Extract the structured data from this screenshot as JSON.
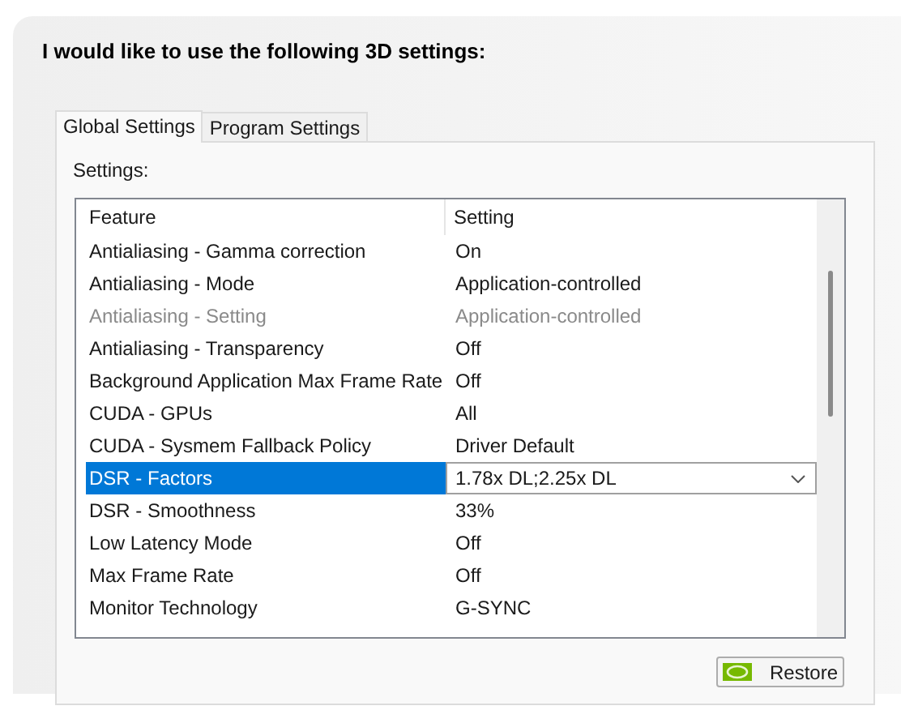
{
  "heading": "I would like to use the following 3D settings:",
  "tabs": [
    {
      "label": "Global Settings",
      "selected": true
    },
    {
      "label": "Program Settings",
      "selected": false
    }
  ],
  "settings_label": "Settings:",
  "table": {
    "columns": [
      "Feature",
      "Setting"
    ],
    "rows": [
      {
        "feature": "Antialiasing - Gamma correction",
        "setting": "On",
        "disabled": false,
        "selected": false
      },
      {
        "feature": "Antialiasing - Mode",
        "setting": "Application-controlled",
        "disabled": false,
        "selected": false
      },
      {
        "feature": "Antialiasing - Setting",
        "setting": "Application-controlled",
        "disabled": true,
        "selected": false
      },
      {
        "feature": "Antialiasing - Transparency",
        "setting": "Off",
        "disabled": false,
        "selected": false
      },
      {
        "feature": "Background Application Max Frame Rate",
        "setting": "Off",
        "disabled": false,
        "selected": false
      },
      {
        "feature": "CUDA - GPUs",
        "setting": "All",
        "disabled": false,
        "selected": false
      },
      {
        "feature": "CUDA - Sysmem Fallback Policy",
        "setting": "Driver Default",
        "disabled": false,
        "selected": false
      },
      {
        "feature": "DSR - Factors",
        "setting": "1.78x DL;2.25x DL",
        "disabled": false,
        "selected": true
      },
      {
        "feature": "DSR - Smoothness",
        "setting": "33%",
        "disabled": false,
        "selected": false
      },
      {
        "feature": "Low Latency Mode",
        "setting": "Off",
        "disabled": false,
        "selected": false
      },
      {
        "feature": "Max Frame Rate",
        "setting": "Off",
        "disabled": false,
        "selected": false
      },
      {
        "feature": "Monitor Technology",
        "setting": "G-SYNC",
        "disabled": false,
        "selected": false
      }
    ]
  },
  "restore_button": "Restore"
}
